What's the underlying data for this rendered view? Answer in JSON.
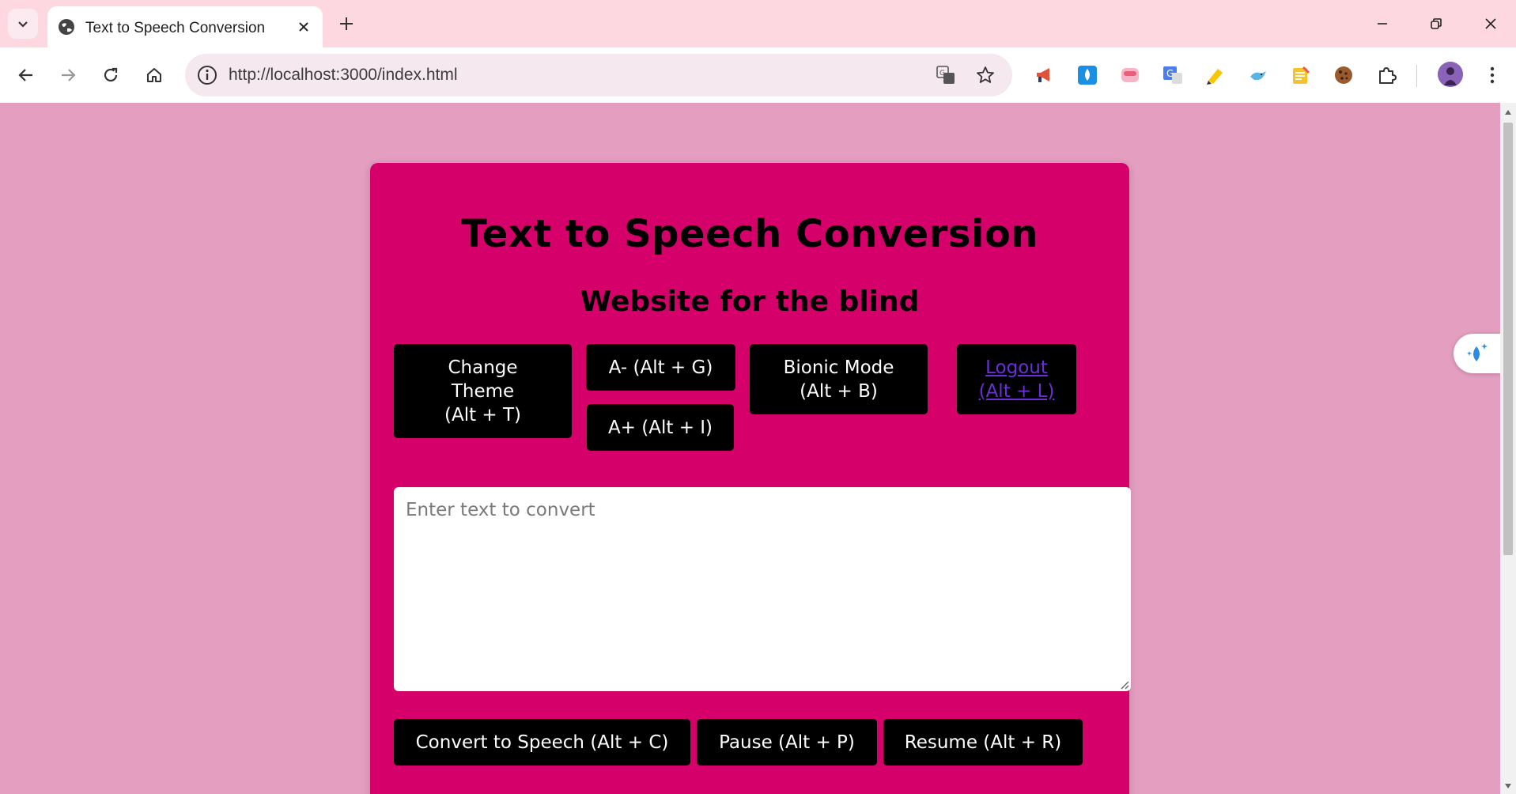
{
  "browser": {
    "tab_title": "Text to Speech Conversion",
    "url": "http://localhost:3000/index.html"
  },
  "page": {
    "title": "Text to Speech Conversion",
    "subtitle": "Website for the blind",
    "buttons": {
      "change_theme": "Change Theme (Alt + T)",
      "font_decrease": "A- (Alt + G)",
      "font_increase": "A+ (Alt + I)",
      "bionic_mode": "Bionic Mode (Alt + B)",
      "logout": "Logout (Alt + L)",
      "convert": "Convert to Speech (Alt + C)",
      "pause": "Pause (Alt + P)",
      "resume": "Resume (Alt + R)"
    },
    "textarea_placeholder": "Enter text to convert"
  },
  "colors": {
    "page_bg": "#e39ec0",
    "card_bg": "#d6006a",
    "button_bg": "#000000",
    "button_text": "#ffffff",
    "link_text": "#6a2fd6",
    "tabbar_bg": "#fdd8e1"
  }
}
